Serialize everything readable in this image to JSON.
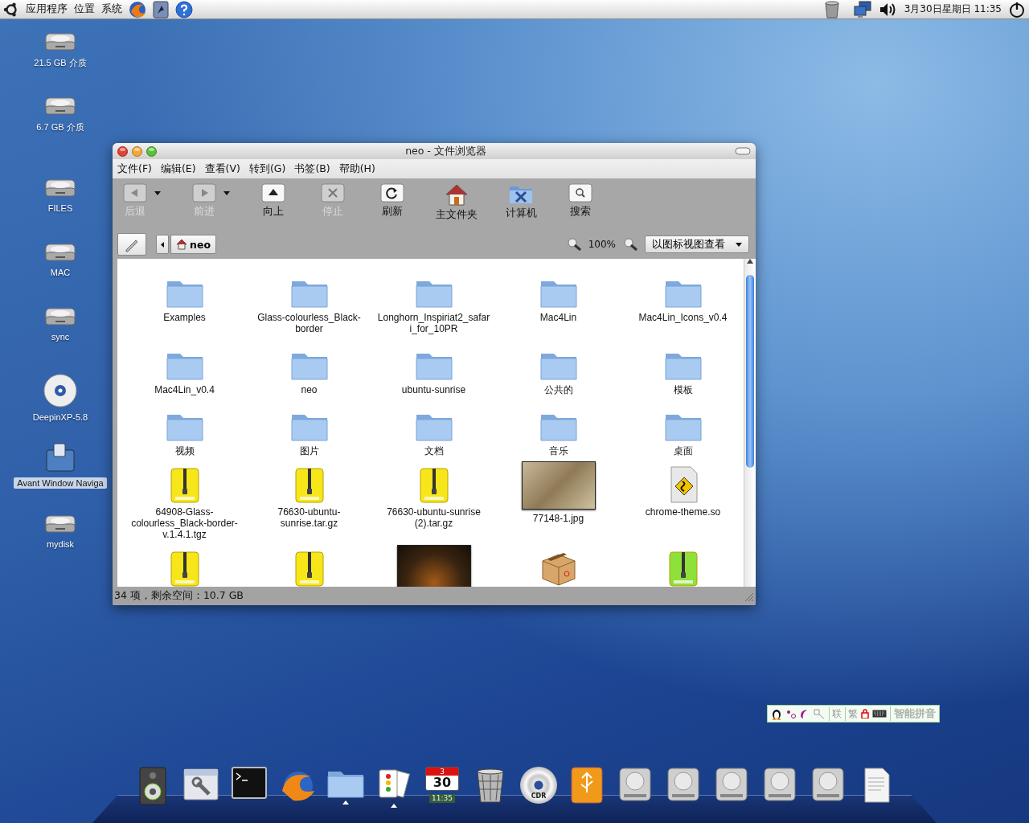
{
  "top_panel": {
    "menus": [
      "应用程序",
      "位置",
      "系统"
    ],
    "clock": "3月30日星期日 11:35"
  },
  "desktop_icons": [
    {
      "label": "21.5 GB 介质",
      "kind": "drive",
      "selected": false
    },
    {
      "label": "6.7 GB 介质",
      "kind": "drive",
      "selected": false
    },
    {
      "label": "FILES",
      "kind": "drive",
      "selected": false
    },
    {
      "label": "MAC",
      "kind": "drive",
      "selected": false
    },
    {
      "label": "sync",
      "kind": "drive",
      "selected": false
    },
    {
      "label": "DeepinXP-5.8",
      "kind": "disc",
      "selected": false
    },
    {
      "label": "Avant Window Naviga",
      "kind": "app",
      "selected": true
    },
    {
      "label": "mydisk",
      "kind": "drive",
      "selected": false
    }
  ],
  "window": {
    "title": "neo - 文件浏览器",
    "menus": [
      "文件(F)",
      "编辑(E)",
      "查看(V)",
      "转到(G)",
      "书签(B)",
      "帮助(H)"
    ],
    "toolbar": [
      {
        "kind": "back",
        "label": "后退",
        "disabled": true,
        "has_menu": true
      },
      {
        "kind": "forward",
        "label": "前进",
        "disabled": true,
        "has_menu": true
      },
      {
        "kind": "up",
        "label": "向上",
        "disabled": false,
        "has_menu": false
      },
      {
        "kind": "stop",
        "label": "停止",
        "disabled": true,
        "has_menu": false
      },
      {
        "kind": "reload",
        "label": "刷新",
        "disabled": false,
        "has_menu": false
      },
      {
        "kind": "home",
        "label": "主文件夹",
        "disabled": false,
        "has_menu": false
      },
      {
        "kind": "computer",
        "label": "计算机",
        "disabled": false,
        "has_menu": false
      },
      {
        "kind": "search",
        "label": "搜索",
        "disabled": false,
        "has_menu": false
      }
    ],
    "location": "neo",
    "zoom": "100%",
    "view_mode": "以图标视图查看",
    "files": [
      {
        "kind": "folder",
        "name": "Examples"
      },
      {
        "kind": "folder",
        "name": "Glass-colourless_Black-border"
      },
      {
        "kind": "folder",
        "name": "Longhorn_Inspiriat2_safari_for_10PR"
      },
      {
        "kind": "folder",
        "name": "Mac4Lin"
      },
      {
        "kind": "folder",
        "name": "Mac4Lin_Icons_v0.4"
      },
      {
        "kind": "folder",
        "name": "Mac4Lin_v0.4"
      },
      {
        "kind": "folder",
        "name": "neo"
      },
      {
        "kind": "folder",
        "name": "ubuntu-sunrise"
      },
      {
        "kind": "folder",
        "name": "公共的"
      },
      {
        "kind": "folder",
        "name": "模板"
      },
      {
        "kind": "folder",
        "name": "视频"
      },
      {
        "kind": "folder",
        "name": "图片"
      },
      {
        "kind": "folder",
        "name": "文档"
      },
      {
        "kind": "folder",
        "name": "音乐"
      },
      {
        "kind": "folder",
        "name": "桌面"
      },
      {
        "kind": "archive",
        "name": "64908-Glass-colourless_Black-border-v.1.4.1.tgz"
      },
      {
        "kind": "archive",
        "name": "76630-ubuntu-sunrise.tar.gz"
      },
      {
        "kind": "archive",
        "name": "76630-ubuntu-sunrise (2).tar.gz"
      },
      {
        "kind": "image",
        "name": "77148-1.jpg"
      },
      {
        "kind": "script",
        "name": "chrome-theme.so"
      },
      {
        "kind": "archive"
      },
      {
        "kind": "archive"
      },
      {
        "kind": "image"
      },
      {
        "kind": "package"
      },
      {
        "kind": "archive-green"
      }
    ],
    "status": "34 项，剩余空间：10.7 GB"
  },
  "input_method": {
    "chars": [
      "联",
      "繁"
    ],
    "label": "智能拼音"
  },
  "dock": [
    {
      "kind": "speaker",
      "running": false
    },
    {
      "kind": "settings",
      "running": false
    },
    {
      "kind": "terminal",
      "running": false
    },
    {
      "kind": "browser",
      "running": false
    },
    {
      "kind": "folder",
      "running": true
    },
    {
      "kind": "cards",
      "running": true
    },
    {
      "kind": "calendar",
      "running": false,
      "month": "3",
      "day": "30",
      "time": "11:35"
    },
    {
      "kind": "trash",
      "running": false
    },
    {
      "kind": "disc",
      "running": false,
      "label": "CDR"
    },
    {
      "kind": "usb",
      "running": false
    },
    {
      "kind": "drive",
      "running": false
    },
    {
      "kind": "drive",
      "running": false
    },
    {
      "kind": "drive",
      "running": false
    },
    {
      "kind": "drive",
      "running": false
    },
    {
      "kind": "drive",
      "running": false
    },
    {
      "kind": "document",
      "running": false
    }
  ]
}
